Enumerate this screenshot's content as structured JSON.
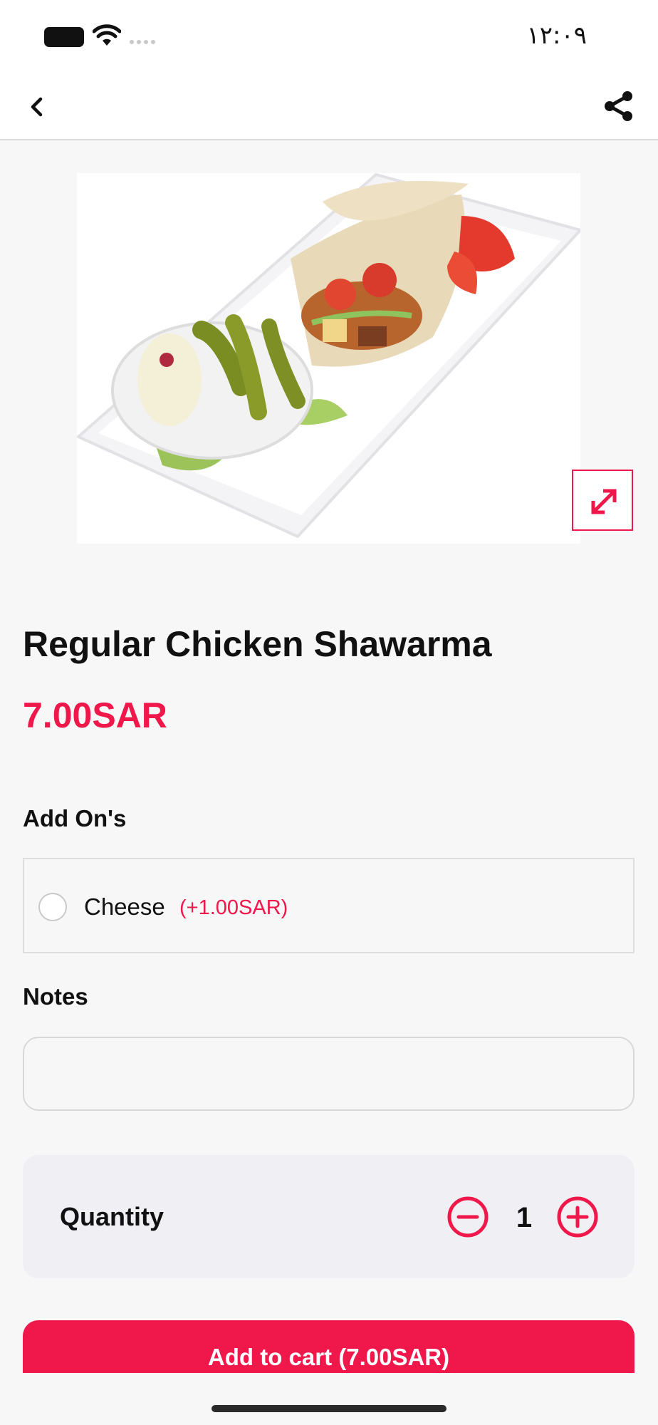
{
  "status_bar": {
    "time": "١٢:٠٩"
  },
  "icons": {
    "back": "chevron-left-icon",
    "share": "share-icon",
    "expand": "expand-icon",
    "minus": "minus-circle-icon",
    "plus": "plus-circle-icon"
  },
  "product": {
    "name": "Regular Chicken Shawarma",
    "price": "7.00SAR"
  },
  "addons": {
    "label": "Add On's",
    "items": [
      {
        "name": "Cheese",
        "price": "(+1.00SAR)",
        "selected": false
      }
    ]
  },
  "notes": {
    "label": "Notes",
    "value": "",
    "placeholder": ""
  },
  "quantity": {
    "label": "Quantity",
    "value": "1"
  },
  "cart_button": {
    "label": "Add to cart (7.00SAR)"
  },
  "colors": {
    "accent": "#f0174a",
    "background": "#f7f7f7",
    "card": "#f0f0f4"
  }
}
